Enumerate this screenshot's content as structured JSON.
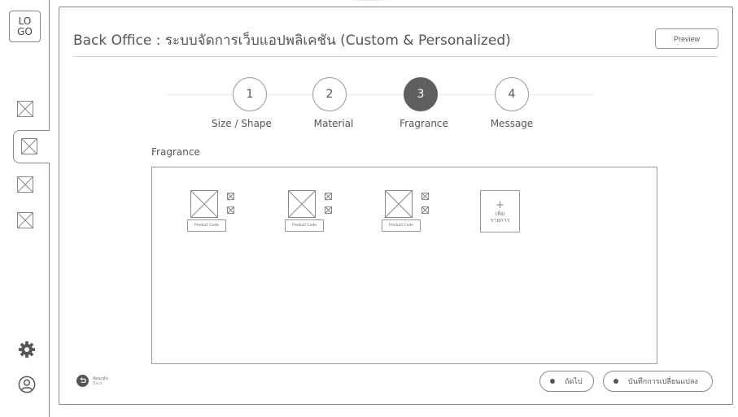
{
  "sidebar": {
    "logo_text": "LO\nGO",
    "nav_items": [
      {
        "icon": "placeholder-image-icon",
        "active": false
      },
      {
        "icon": "placeholder-image-icon",
        "active": true
      },
      {
        "icon": "placeholder-image-icon",
        "active": false
      },
      {
        "icon": "placeholder-image-icon",
        "active": false
      }
    ],
    "settings_icon": "gear-icon",
    "user_icon": "user-icon"
  },
  "header": {
    "title": "Back Office : ระบบจัดการเว็บแอปพลิเคชัน (Custom & Personalized)",
    "preview_label": "Preview"
  },
  "stepper": {
    "steps": [
      {
        "number": "1",
        "label": "Size / Shape",
        "active": false
      },
      {
        "number": "2",
        "label": "Material",
        "active": false
      },
      {
        "number": "3",
        "label": "Fragrance",
        "active": true
      },
      {
        "number": "4",
        "label": "Message",
        "active": false
      }
    ]
  },
  "section": {
    "label": "Fragrance",
    "products": [
      {
        "code_label": "Product Code"
      },
      {
        "code_label": "Product Code"
      },
      {
        "code_label": "Product Code"
      }
    ],
    "add_item": {
      "plus": "+",
      "label": "เพิ่ม\nรายการ"
    }
  },
  "footer": {
    "back_label": "ย้อนกลับ",
    "back_sublabel": "Back",
    "next_label": "ถัดไป",
    "save_label": "บันทึกการเปลี่ยนแปลง"
  },
  "colors": {
    "active_step": "#5f5f5f",
    "border": "#8a8a8a",
    "text": "#555555"
  }
}
